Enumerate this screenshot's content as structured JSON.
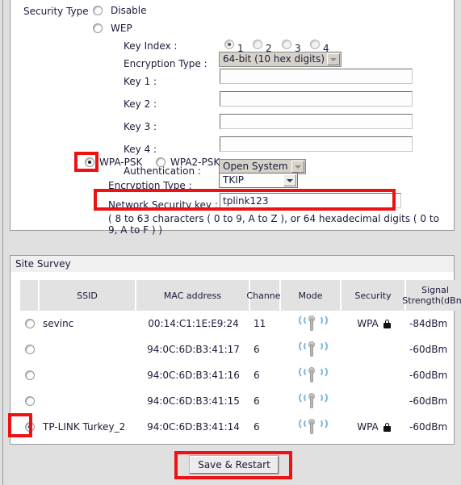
{
  "security": {
    "type_label": "Security Type",
    "options": {
      "disable": "Disable",
      "wep": "WEP",
      "wpa_psk": "WPA-PSK",
      "wpa2_psk": "WPA2-PSK"
    },
    "key_index_label": "Key Index :",
    "key_index_options": [
      "1",
      "2",
      "3",
      "4"
    ],
    "key_index_selected": "1",
    "wep_encryption_label": "Encryption Type :",
    "wep_encryption_value": "64-bit (10 hex digits)",
    "keys": [
      {
        "label": "Key 1 :",
        "value": ""
      },
      {
        "label": "Key 2 :",
        "value": ""
      },
      {
        "label": "Key 3 :",
        "value": ""
      },
      {
        "label": "Key 4 :",
        "value": ""
      }
    ],
    "authentication_label": "Authentication :",
    "authentication_value": "Open System",
    "wpa_encryption_label": "Encryption Type :",
    "wpa_encryption_value": "TKIP",
    "network_key_label": "Network Security key :",
    "network_key_value": "tplink123",
    "key_hint": "( 8 to 63 characters ( 0 to 9, A to Z ), or 64 hexadecimal digits ( 0 to 9, A to F ) )"
  },
  "survey": {
    "title": "Site Survey",
    "columns": [
      "",
      "SSID",
      "MAC address",
      "Channel",
      "Mode",
      "Security",
      "Signal Strength(dBm)"
    ],
    "column_signal_line1": "Signal",
    "column_signal_line2": "Strength(dBm)",
    "rows": [
      {
        "selected": false,
        "ssid": "sevinc",
        "mac": "00:14:C1:1E:E9:24",
        "channel": "11",
        "mode": "wifi-icon",
        "security": "WPA",
        "locked": true,
        "signal": "-84dBm"
      },
      {
        "selected": false,
        "ssid": "",
        "mac": "94:0C:6D:B3:41:17",
        "channel": "6",
        "mode": "wifi-icon",
        "security": "",
        "locked": false,
        "signal": "-60dBm"
      },
      {
        "selected": false,
        "ssid": "",
        "mac": "94:0C:6D:B3:41:16",
        "channel": "6",
        "mode": "wifi-icon",
        "security": "",
        "locked": false,
        "signal": "-60dBm"
      },
      {
        "selected": false,
        "ssid": "",
        "mac": "94:0C:6D:B3:41:15",
        "channel": "6",
        "mode": "wifi-icon",
        "security": "",
        "locked": false,
        "signal": "-60dBm"
      },
      {
        "selected": true,
        "ssid": "TP-LINK Turkey_2",
        "mac": "94:0C:6D:B3:41:14",
        "channel": "6",
        "mode": "wifi-icon",
        "security": "WPA",
        "locked": true,
        "signal": "-60dBm"
      }
    ]
  },
  "actions": {
    "save_restart": "Save & Restart"
  },
  "colors": {
    "highlight": "#ee1111",
    "panel_bg": "#ffffff",
    "page_bg": "#e0e0e0",
    "header_bg": "#e2e2e2"
  }
}
